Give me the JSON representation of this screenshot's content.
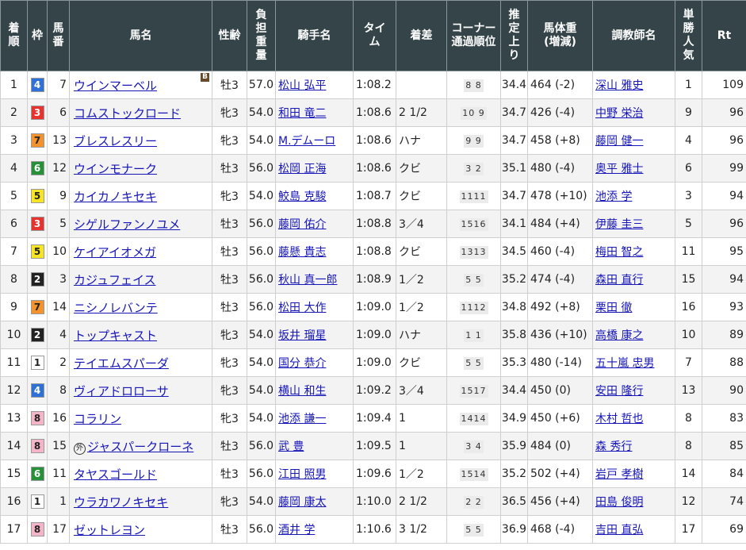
{
  "headers": {
    "finish": [
      "着",
      "順"
    ],
    "waku": "枠",
    "umaban": [
      "馬",
      "番"
    ],
    "horse": "馬名",
    "sexage": "性齢",
    "weight": [
      "負",
      "担",
      "重",
      "量"
    ],
    "jockey": "騎手名",
    "time": [
      "タイ",
      "ム"
    ],
    "margin": "着差",
    "corner": [
      "コーナー",
      "通過順位"
    ],
    "last3f": [
      "推",
      "定",
      "上",
      "り"
    ],
    "bodyweight": [
      "馬体重",
      "(増減)"
    ],
    "trainer": "調教師名",
    "pop": [
      "単",
      "勝",
      "人",
      "気"
    ],
    "rt": "Rt"
  },
  "waku_colors": {
    "1": {
      "bg": "#ffffff",
      "fg": "#222222"
    },
    "2": {
      "bg": "#222222",
      "fg": "#ffffff"
    },
    "3": {
      "bg": "#e8322d",
      "fg": "#ffffff"
    },
    "4": {
      "bg": "#2f6fd8",
      "fg": "#ffffff"
    },
    "5": {
      "bg": "#f6e525",
      "fg": "#222222"
    },
    "6": {
      "bg": "#27913a",
      "fg": "#ffffff"
    },
    "7": {
      "bg": "#f4922b",
      "fg": "#222222"
    },
    "8": {
      "bg": "#f5b5c8",
      "fg": "#222222"
    }
  },
  "rows": [
    {
      "finish": "1",
      "waku": "4",
      "umaban": "7",
      "horse": "ウインマーベル",
      "mark": "",
      "blinker": "B",
      "sexage": "牡3",
      "weight": "57.0",
      "jockey": "松山 弘平",
      "time": "1:08.2",
      "margin": "",
      "corner": "8 8",
      "last3f": "34.4",
      "bodyweight": "464 (-2)",
      "trainer": "深山 雅史",
      "pop": "1",
      "rt": "109"
    },
    {
      "finish": "2",
      "waku": "3",
      "umaban": "6",
      "horse": "コムストックロード",
      "mark": "",
      "blinker": "",
      "sexage": "牝3",
      "weight": "54.0",
      "jockey": "和田 竜二",
      "time": "1:08.6",
      "margin": "2 1/2",
      "corner": "10 9",
      "last3f": "34.7",
      "bodyweight": "426 (-4)",
      "trainer": "中野 栄治",
      "pop": "9",
      "rt": "96"
    },
    {
      "finish": "3",
      "waku": "7",
      "umaban": "13",
      "horse": "ブレスレスリー",
      "mark": "",
      "blinker": "",
      "sexage": "牝3",
      "weight": "54.0",
      "jockey": "M.デムーロ",
      "time": "1:08.6",
      "margin": "ハナ",
      "corner": "9 9",
      "last3f": "34.7",
      "bodyweight": "458 (+8)",
      "trainer": "藤岡 健一",
      "pop": "4",
      "rt": "96"
    },
    {
      "finish": "4",
      "waku": "6",
      "umaban": "12",
      "horse": "ウインモナーク",
      "mark": "",
      "blinker": "",
      "sexage": "牡3",
      "weight": "56.0",
      "jockey": "松岡 正海",
      "time": "1:08.6",
      "margin": "クビ",
      "corner": "3 2",
      "last3f": "35.1",
      "bodyweight": "480 (-4)",
      "trainer": "奥平 雅士",
      "pop": "6",
      "rt": "99"
    },
    {
      "finish": "5",
      "waku": "5",
      "umaban": "9",
      "horse": "カイカノキセキ",
      "mark": "",
      "blinker": "",
      "sexage": "牝3",
      "weight": "54.0",
      "jockey": "鮫島 克駿",
      "time": "1:08.7",
      "margin": "クビ",
      "corner": "1111",
      "last3f": "34.7",
      "bodyweight": "478 (+10)",
      "trainer": "池添 学",
      "pop": "3",
      "rt": "94"
    },
    {
      "finish": "6",
      "waku": "3",
      "umaban": "5",
      "horse": "シゲルファンノユメ",
      "mark": "",
      "blinker": "",
      "sexage": "牡3",
      "weight": "56.0",
      "jockey": "藤岡 佑介",
      "time": "1:08.8",
      "margin": "3／4",
      "corner": "1516",
      "last3f": "34.1",
      "bodyweight": "484 (+4)",
      "trainer": "伊藤 圭三",
      "pop": "5",
      "rt": "96"
    },
    {
      "finish": "7",
      "waku": "5",
      "umaban": "10",
      "horse": "ケイアイオメガ",
      "mark": "",
      "blinker": "",
      "sexage": "牡3",
      "weight": "56.0",
      "jockey": "藤懸 貴志",
      "time": "1:08.8",
      "margin": "クビ",
      "corner": "1313",
      "last3f": "34.5",
      "bodyweight": "460 (-4)",
      "trainer": "梅田 智之",
      "pop": "11",
      "rt": "95"
    },
    {
      "finish": "8",
      "waku": "2",
      "umaban": "3",
      "horse": "カジュフェイス",
      "mark": "",
      "blinker": "",
      "sexage": "牡3",
      "weight": "56.0",
      "jockey": "秋山 真一郎",
      "time": "1:08.9",
      "margin": "1／2",
      "corner": "5 5",
      "last3f": "35.2",
      "bodyweight": "474 (-4)",
      "trainer": "森田 直行",
      "pop": "15",
      "rt": "94"
    },
    {
      "finish": "9",
      "waku": "7",
      "umaban": "14",
      "horse": "ニシノレバンテ",
      "mark": "",
      "blinker": "",
      "sexage": "牡3",
      "weight": "56.0",
      "jockey": "松田 大作",
      "time": "1:09.0",
      "margin": "1／2",
      "corner": "1112",
      "last3f": "34.8",
      "bodyweight": "492 (+8)",
      "trainer": "栗田 徹",
      "pop": "16",
      "rt": "93"
    },
    {
      "finish": "10",
      "waku": "2",
      "umaban": "4",
      "horse": "トップキャスト",
      "mark": "",
      "blinker": "",
      "sexage": "牝3",
      "weight": "54.0",
      "jockey": "坂井 瑠星",
      "time": "1:09.0",
      "margin": "ハナ",
      "corner": "1 1",
      "last3f": "35.8",
      "bodyweight": "436 (+10)",
      "trainer": "高橋 康之",
      "pop": "10",
      "rt": "89"
    },
    {
      "finish": "11",
      "waku": "1",
      "umaban": "2",
      "horse": "テイエムスパーダ",
      "mark": "",
      "blinker": "",
      "sexage": "牝3",
      "weight": "54.0",
      "jockey": "国分 恭介",
      "time": "1:09.0",
      "margin": "クビ",
      "corner": "5 5",
      "last3f": "35.3",
      "bodyweight": "480 (-14)",
      "trainer": "五十嵐 忠男",
      "pop": "7",
      "rt": "88"
    },
    {
      "finish": "12",
      "waku": "4",
      "umaban": "8",
      "horse": "ヴィアドロローサ",
      "mark": "",
      "blinker": "",
      "sexage": "牝3",
      "weight": "54.0",
      "jockey": "横山 和生",
      "time": "1:09.2",
      "margin": "3／4",
      "corner": "1517",
      "last3f": "34.4",
      "bodyweight": "450 (0)",
      "trainer": "安田 隆行",
      "pop": "13",
      "rt": "90"
    },
    {
      "finish": "13",
      "waku": "8",
      "umaban": "16",
      "horse": "コラリン",
      "mark": "",
      "blinker": "",
      "sexage": "牝3",
      "weight": "54.0",
      "jockey": "池添 謙一",
      "time": "1:09.4",
      "margin": "1",
      "corner": "1414",
      "last3f": "34.9",
      "bodyweight": "450 (+6)",
      "trainer": "木村 哲也",
      "pop": "8",
      "rt": "83"
    },
    {
      "finish": "14",
      "waku": "8",
      "umaban": "15",
      "horse": "ジャスパークローネ",
      "mark": "外",
      "blinker": "",
      "sexage": "牡3",
      "weight": "56.0",
      "jockey": "武 豊",
      "time": "1:09.5",
      "margin": "1",
      "corner": "3 4",
      "last3f": "35.9",
      "bodyweight": "484 (0)",
      "trainer": "森 秀行",
      "pop": "8",
      "rt": "85"
    },
    {
      "finish": "15",
      "waku": "6",
      "umaban": "11",
      "horse": "タヤスゴールド",
      "mark": "",
      "blinker": "",
      "sexage": "牡3",
      "weight": "56.0",
      "jockey": "江田 照男",
      "time": "1:09.6",
      "margin": "1／2",
      "corner": "1514",
      "last3f": "35.2",
      "bodyweight": "502 (+4)",
      "trainer": "岩戸 孝樹",
      "pop": "14",
      "rt": "84"
    },
    {
      "finish": "16",
      "waku": "1",
      "umaban": "1",
      "horse": "ウラカワノキセキ",
      "mark": "",
      "blinker": "",
      "sexage": "牝3",
      "weight": "54.0",
      "jockey": "藤岡 康太",
      "time": "1:10.0",
      "margin": "2 1/2",
      "corner": "2 2",
      "last3f": "36.5",
      "bodyweight": "456 (+4)",
      "trainer": "田島 俊明",
      "pop": "12",
      "rt": "74"
    },
    {
      "finish": "17",
      "waku": "8",
      "umaban": "17",
      "horse": "ゼットレヨン",
      "mark": "",
      "blinker": "",
      "sexage": "牡3",
      "weight": "56.0",
      "jockey": "酒井 学",
      "time": "1:10.6",
      "margin": "3 1/2",
      "corner": "5 5",
      "last3f": "36.9",
      "bodyweight": "468 (-4)",
      "trainer": "吉田 直弘",
      "pop": "17",
      "rt": "69"
    }
  ]
}
